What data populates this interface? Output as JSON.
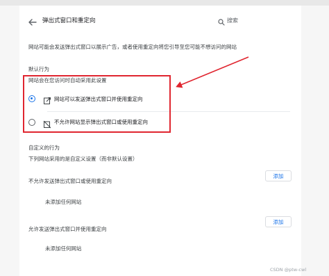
{
  "header": {
    "title": "弹出式窗口和重定向",
    "search_placeholder": "搜索"
  },
  "description": "网站可能会发送弹出式窗口以展示广告，或者使用重定向将您引导至您可能不想访问的网站",
  "default_behavior": {
    "heading": "默认行为",
    "subheading": "网站会在您访问时自动采用此设置",
    "options": [
      {
        "label": "网站可以发送弹出式窗口并使用重定向",
        "selected": true,
        "icon": "external-link-icon"
      },
      {
        "label": "不允许网站显示弹出式窗口或使用重定向",
        "selected": false,
        "icon": "popup-blocked-icon"
      }
    ]
  },
  "custom_behavior": {
    "heading": "自定义的行为",
    "subheading": "下列网站采用的是自定义设置（而非默认设置）",
    "blocked": {
      "label": "不允许发送弹出式窗口或使用重定向",
      "add_label": "添加",
      "empty_text": "未添加任何网站"
    },
    "allowed": {
      "label": "允许发送弹出式窗口并使用重定向",
      "add_label": "添加",
      "empty_text": "未添加任何网站"
    }
  },
  "annotation": {
    "highlight_color": "#e0252f"
  },
  "accent_color": "#1a73e8",
  "watermark": "CSDN @ptw-cwl"
}
